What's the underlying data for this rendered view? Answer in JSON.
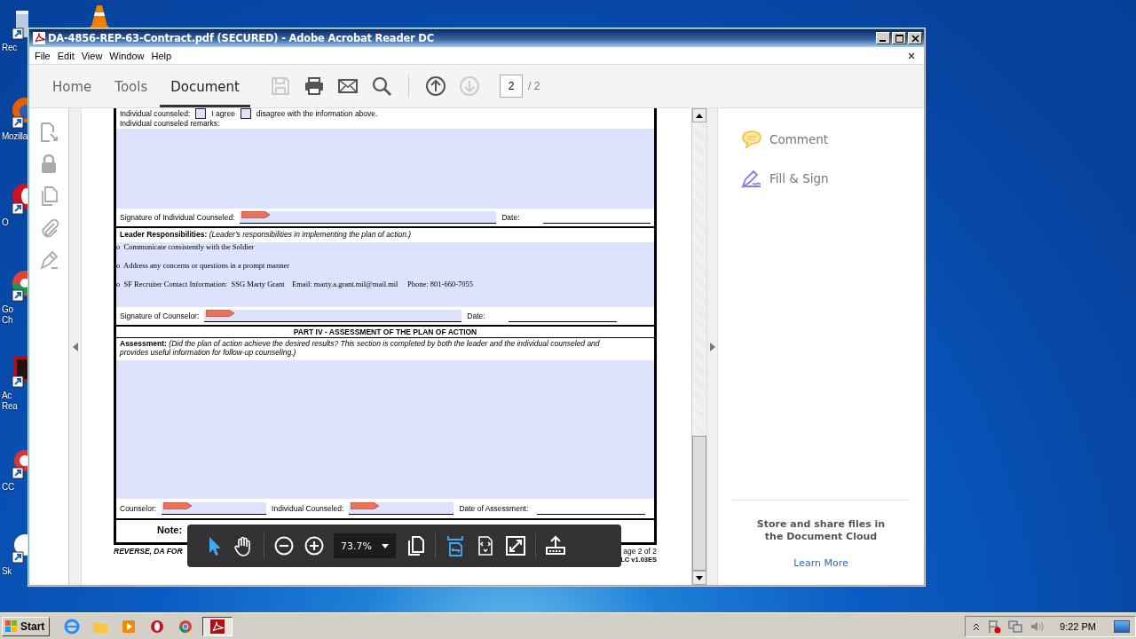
{
  "window": {
    "title": "DA-4856-REP-63-Contract.pdf (SECURED) - Adobe Acrobat Reader DC"
  },
  "menu": [
    "File",
    "Edit",
    "View",
    "Window",
    "Help"
  ],
  "tabs": [
    {
      "label": "Home",
      "selected": false
    },
    {
      "label": "Tools",
      "selected": false
    },
    {
      "label": "Document",
      "selected": true
    }
  ],
  "toolbar": [
    {
      "kind": "save",
      "disabled": true
    },
    {
      "kind": "print",
      "disabled": false
    },
    {
      "kind": "email",
      "disabled": false
    },
    {
      "kind": "search",
      "disabled": false
    },
    {
      "kind": "page-up",
      "disabled": false
    },
    {
      "kind": "page-down",
      "disabled": true
    }
  ],
  "page_field": {
    "value": "2"
  },
  "page_total": "/ 2",
  "left_tools": [
    {
      "kind": "export"
    },
    {
      "kind": "lock"
    },
    {
      "kind": "pages"
    },
    {
      "kind": "attach"
    },
    {
      "kind": "sign"
    }
  ],
  "form": {
    "agree_row": {
      "label": "Individual counseled:",
      "options": [
        {
          "label": "I agree",
          "checked": false
        },
        {
          "label": "disagree with the information above.",
          "checked": false
        }
      ]
    },
    "remarks_label": "Individual counseled remarks:",
    "sig_individual": {
      "label": "Signature of Individual Counseled:",
      "date_label": "Date:"
    },
    "leader_title": "**Leader Responsibilities:**  *(Leader's responsibilities in implementing the plan of action.)*",
    "leader_items": [
      "o  Communicate consistently with the Soldier",
      "o  Address any concerns or questions in a prompt manner",
      "o  SF Recruiter Contact Information:  SSG Marty Grant    Email: marty.a.grant.mil@mail.mil     Phone: 801-660-7055"
    ],
    "sig_counselor": {
      "label": "Signature of Counselor:",
      "date_label": "Date:"
    },
    "part4_title": "PART IV - ASSESSMENT OF THE PLAN OF ACTION",
    "assessment": "**Assessment:** *(Did the plan of action achieve the desired results?  This section is completed by both the leader and the individual counseled and provides useful information for follow-up counseling.)*",
    "final_row": [
      {
        "kind": "signature",
        "label": "Counselor:"
      },
      {
        "kind": "signature",
        "label": "Individual Counseled:"
      },
      {
        "kind": "date",
        "label": "Date of Assessment:"
      }
    ],
    "note": "Note:",
    "footer_left": "REVERSE, DA FOR",
    "footer_right": "age 2 of 2",
    "footer_version": "LC v1.03ES"
  },
  "floating_toolbar": {
    "tools": [
      {
        "kind": "select",
        "on": true
      },
      {
        "kind": "hand",
        "on": false
      },
      {
        "kind": "zoom-out",
        "on": false
      },
      {
        "kind": "zoom-in",
        "on": false
      }
    ],
    "zoom": "73.7%",
    "views": [
      {
        "kind": "pages",
        "on": false
      },
      {
        "kind": "fit-width",
        "on": true
      },
      {
        "kind": "fit-page",
        "on": false
      },
      {
        "kind": "full-screen",
        "on": false
      },
      {
        "kind": "share",
        "on": false
      }
    ]
  },
  "right_pane": {
    "tools": [
      {
        "kind": "comment",
        "label": "Comment"
      },
      {
        "kind": "fill-sign",
        "label": "Fill & Sign"
      }
    ],
    "promo": "Store and share files in the Document Cloud",
    "link": "Learn More"
  },
  "desktop_icons": [
    {
      "kind": "recycle",
      "label": [
        "Rec"
      ]
    },
    {
      "kind": "firefox",
      "label": [
        "Mozilla"
      ]
    },
    {
      "kind": "opera",
      "label": [
        "O"
      ]
    },
    {
      "kind": "chrome",
      "label": [
        "Go",
        "Ch"
      ]
    },
    {
      "kind": "acrobat",
      "label": [
        "Ac",
        "Rea"
      ]
    },
    {
      "kind": "ccleaner",
      "label": [
        "CC"
      ]
    },
    {
      "kind": "skype",
      "label": [
        "Sk"
      ]
    }
  ],
  "taskbar": {
    "start": "Start",
    "apps": [
      {
        "kind": "ie",
        "active": false
      },
      {
        "kind": "folder",
        "active": false
      },
      {
        "kind": "media",
        "active": false
      },
      {
        "kind": "opera",
        "active": false
      },
      {
        "kind": "chrome",
        "active": false
      },
      {
        "kind": "acrobat",
        "active": true
      }
    ],
    "clock": "9:22 PM"
  }
}
